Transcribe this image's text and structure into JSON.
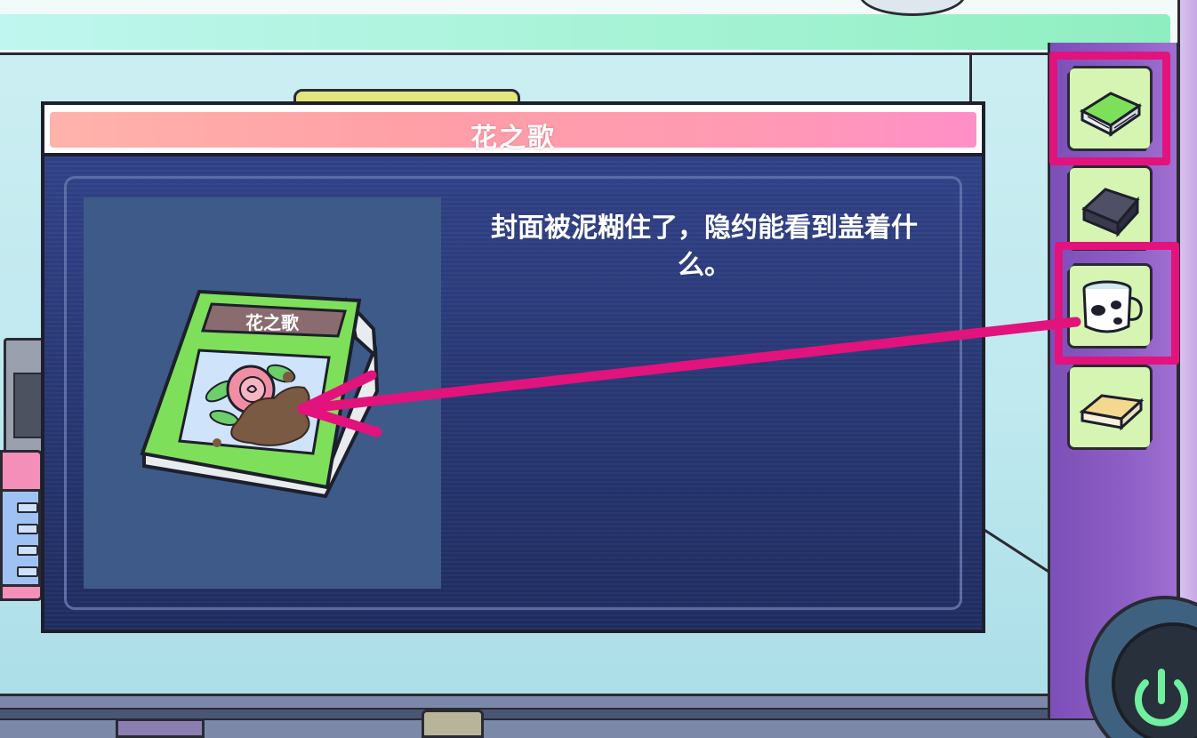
{
  "item_detail": {
    "title": "花之歌",
    "description": "封面被泥糊住了，隐约能看到盖着什么。",
    "book_cover_label": "花之歌"
  },
  "inventory": {
    "slots": [
      {
        "item": "green-book-icon",
        "highlighted": true
      },
      {
        "item": "dark-box-icon",
        "highlighted": false
      },
      {
        "item": "cow-mug-icon",
        "highlighted": true
      },
      {
        "item": "sponge-icon",
        "highlighted": false
      }
    ]
  },
  "colors": {
    "highlight": "#e2137c",
    "title_bar": "#ff9fa7",
    "modal_body": "#2c3a78",
    "book_green": "#7ee05a"
  }
}
